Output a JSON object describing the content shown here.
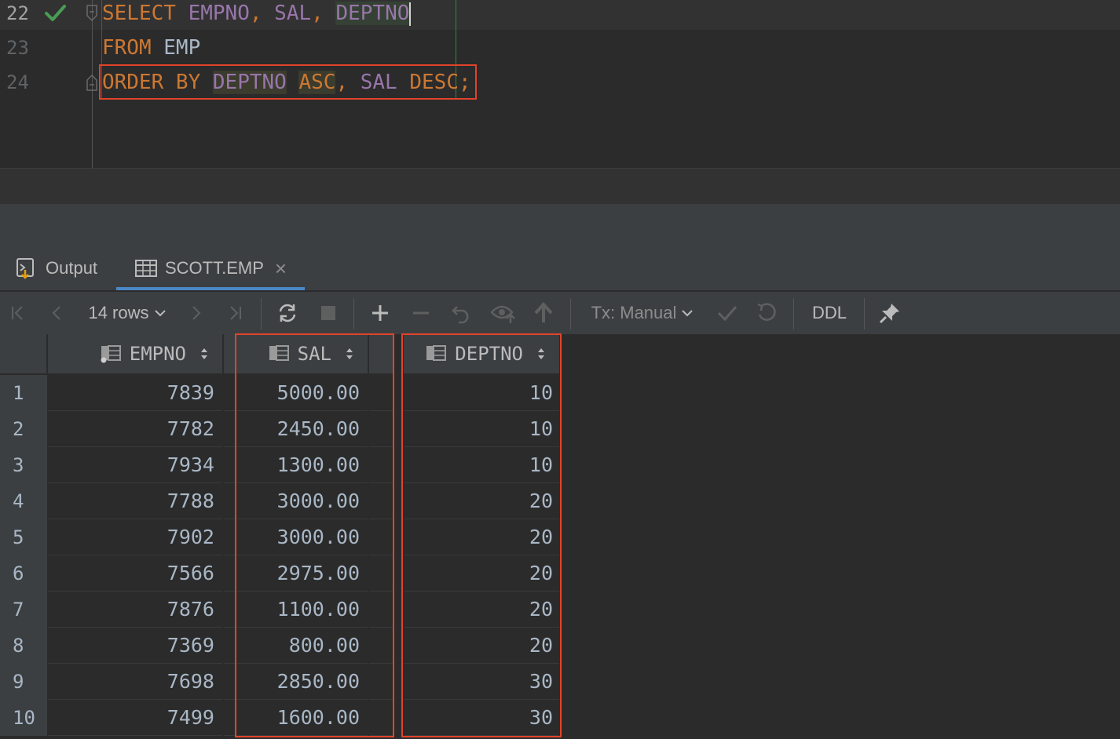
{
  "editor": {
    "line_numbers": [
      "22",
      "23",
      "24"
    ],
    "line1": {
      "kw1": "SELECT",
      "c1": "EMPNO",
      "p1": ",",
      "c2": "SAL",
      "p2": ",",
      "c3": "DEPTNO"
    },
    "line2": {
      "kw1": "FROM",
      "t1": "EMP"
    },
    "line3": {
      "kw1": "ORDER BY",
      "c1": "DEPTNO",
      "kw2": "ASC",
      "p1": ",",
      "c2": "SAL",
      "kw3": "DESC",
      "p2": ";"
    }
  },
  "tabs": [
    {
      "label": "Output",
      "icon": "output-icon"
    },
    {
      "label": "SCOTT.EMP",
      "icon": "table-icon",
      "close": "×"
    }
  ],
  "toolbar": {
    "rows_label": "14 rows",
    "tx_label": "Tx: Manual",
    "ddl_label": "DDL"
  },
  "grid": {
    "columns": [
      "EMPNO",
      "SAL",
      "DEPTNO"
    ],
    "rows": [
      {
        "num": "1",
        "empno": "7839",
        "sal": "5000.00",
        "deptno": "10"
      },
      {
        "num": "2",
        "empno": "7782",
        "sal": "2450.00",
        "deptno": "10"
      },
      {
        "num": "3",
        "empno": "7934",
        "sal": "1300.00",
        "deptno": "10"
      },
      {
        "num": "4",
        "empno": "7788",
        "sal": "3000.00",
        "deptno": "20"
      },
      {
        "num": "5",
        "empno": "7902",
        "sal": "3000.00",
        "deptno": "20"
      },
      {
        "num": "6",
        "empno": "7566",
        "sal": "2975.00",
        "deptno": "20"
      },
      {
        "num": "7",
        "empno": "7876",
        "sal": "1100.00",
        "deptno": "20"
      },
      {
        "num": "8",
        "empno": "7369",
        "sal": "800.00",
        "deptno": "20"
      },
      {
        "num": "9",
        "empno": "7698",
        "sal": "2850.00",
        "deptno": "30"
      },
      {
        "num": "10",
        "empno": "7499",
        "sal": "1600.00",
        "deptno": "30"
      }
    ]
  },
  "colors": {
    "keyword": "#cc7832",
    "identifier": "#9876aa",
    "highlight_box": "#e2432a",
    "success_check": "#499c54"
  }
}
